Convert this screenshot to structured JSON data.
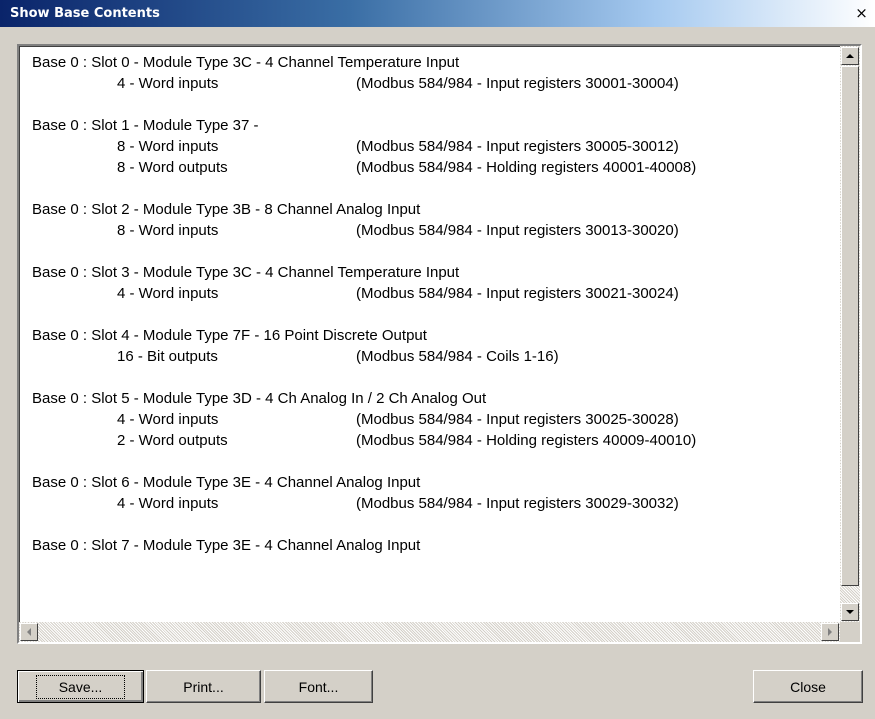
{
  "window": {
    "title": "Show Base Contents",
    "close_glyph": "×"
  },
  "entries": [
    {
      "header": "Base 0 : Slot 0 - Module Type 3C - 4 Channel Temperature Input",
      "rows": [
        {
          "count": "4 - Word inputs",
          "desc": "(Modbus 584/984 - Input registers 30001-30004)"
        }
      ]
    },
    {
      "header": "Base 0 : Slot 1 - Module Type 37 -",
      "rows": [
        {
          "count": "8 - Word inputs",
          "desc": "(Modbus 584/984 - Input registers 30005-30012)"
        },
        {
          "count": "8 - Word outputs",
          "desc": "(Modbus 584/984 - Holding registers 40001-40008)"
        }
      ]
    },
    {
      "header": "Base 0 : Slot 2 - Module Type 3B - 8 Channel Analog Input",
      "rows": [
        {
          "count": "8 - Word inputs",
          "desc": "(Modbus 584/984 - Input registers 30013-30020)"
        }
      ]
    },
    {
      "header": "Base 0 : Slot 3 - Module Type 3C - 4 Channel Temperature Input",
      "rows": [
        {
          "count": "4 - Word inputs",
          "desc": "(Modbus 584/984 - Input registers 30021-30024)"
        }
      ]
    },
    {
      "header": "Base 0 : Slot 4 - Module Type 7F - 16 Point Discrete Output",
      "rows": [
        {
          "count": "16 - Bit outputs",
          "desc": "(Modbus 584/984 - Coils 1-16)"
        }
      ]
    },
    {
      "header": "Base 0 : Slot 5 - Module Type 3D - 4 Ch Analog In / 2 Ch Analog Out",
      "rows": [
        {
          "count": "4 - Word inputs",
          "desc": "(Modbus 584/984 - Input registers 30025-30028)"
        },
        {
          "count": "2 - Word outputs",
          "desc": "(Modbus 584/984 - Holding registers 40009-40010)"
        }
      ]
    },
    {
      "header": "Base 0 : Slot 6 - Module Type 3E - 4 Channel Analog Input",
      "rows": [
        {
          "count": "4 - Word inputs",
          "desc": "(Modbus 584/984 - Input registers 30029-30032)"
        }
      ]
    },
    {
      "header": "Base 0 : Slot 7 - Module Type 3E - 4 Channel Analog Input",
      "rows": []
    }
  ],
  "buttons": {
    "save": "Save...",
    "print": "Print...",
    "font": "Font...",
    "close": "Close"
  }
}
